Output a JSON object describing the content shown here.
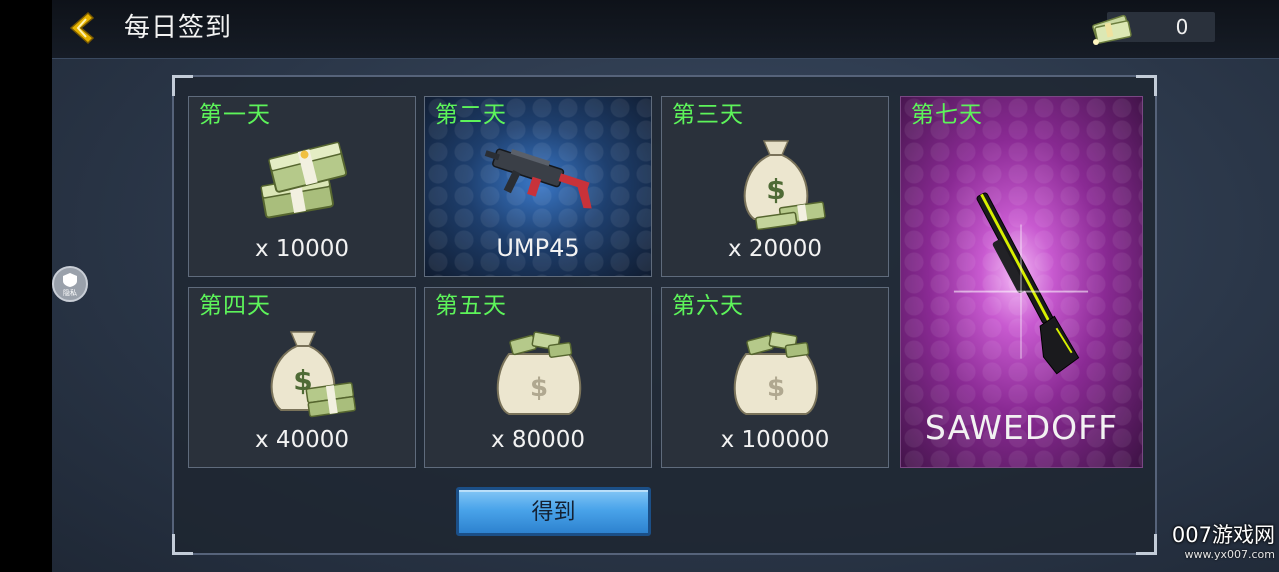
{
  "header": {
    "title": "每日签到",
    "coins": "0"
  },
  "privacy_badge": {
    "label": "隐私"
  },
  "rewards": [
    {
      "day": "第一天",
      "amount": "x 10000",
      "kind": "cash-stack"
    },
    {
      "day": "第二天",
      "amount": "UMP45",
      "kind": "weapon-smg"
    },
    {
      "day": "第三天",
      "amount": "x 20000",
      "kind": "money-bag"
    },
    {
      "day": "第四天",
      "amount": "x 40000",
      "kind": "money-bag"
    },
    {
      "day": "第五天",
      "amount": "x 80000",
      "kind": "money-sack"
    },
    {
      "day": "第六天",
      "amount": "x 100000",
      "kind": "money-sack"
    },
    {
      "day": "第七天",
      "amount": "SAWEDOFF",
      "kind": "weapon-shotgun"
    }
  ],
  "get_button": {
    "label": "得到"
  },
  "watermark": {
    "brand": "007游戏网",
    "url": "www.yx007.com"
  },
  "colors": {
    "day_label": "#5df45a",
    "accent_gold": "#e6b300",
    "button_blue": "#4aa4ea"
  }
}
